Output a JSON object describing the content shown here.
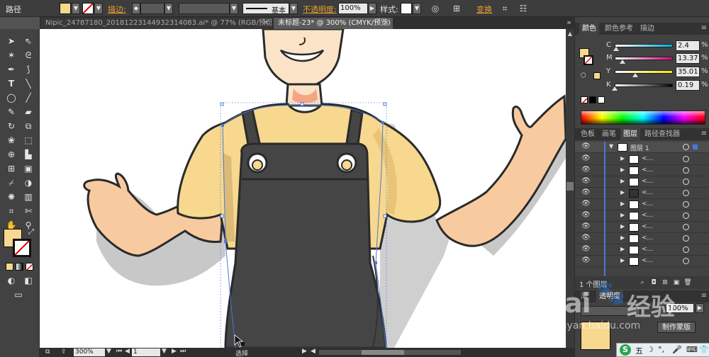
{
  "control_bar": {
    "path_label": "路径",
    "stroke_label": "描边:",
    "stroke_style": "基本",
    "opacity_label": "不透明度:",
    "opacity_value": "100%",
    "style_label": "样式:",
    "transform_label": "变换",
    "fill_color": "#f7d88e"
  },
  "tabs": [
    {
      "label": "Nipic_24787180_20181223144932314083.ai* @ 77% (RGB/预览)",
      "active": false
    },
    {
      "label": "未标题-23* @ 300% (CMYK/预览)",
      "active": true
    }
  ],
  "status": {
    "zoom": "300%",
    "page": "1",
    "tool_label": "选择"
  },
  "color_panel": {
    "tabs": [
      "颜色",
      "颜色参考",
      "描边"
    ],
    "channels": [
      {
        "name": "C",
        "value": "2.4",
        "level": 0.024,
        "gradient": [
          "#ffffff",
          "#00a9e0"
        ]
      },
      {
        "name": "M",
        "value": "13.37",
        "level": 0.1337,
        "gradient": [
          "#ffffff",
          "#e6007e"
        ]
      },
      {
        "name": "Y",
        "value": "35.01",
        "level": 0.3501,
        "gradient": [
          "#ffffff",
          "#ffe500"
        ]
      },
      {
        "name": "K",
        "value": "0.19",
        "level": 0.0019,
        "gradient": [
          "#ffffff",
          "#000000"
        ]
      }
    ],
    "percent": "%"
  },
  "layers_panel": {
    "tabs": [
      "色板",
      "画笔",
      "图层",
      "路径查找器"
    ],
    "top_layer_name": "图层 1",
    "sublayer_names": [
      "<...",
      "<...",
      "<...",
      "<...",
      "<...",
      "<...",
      "<...",
      "<...",
      "<...",
      "<...",
      "<...",
      "<..."
    ],
    "layer_count": "1 个图层"
  },
  "lower_panel": {
    "tab_a": "渐",
    "tab_b": "透明度",
    "opacity_value": "100%",
    "make_mask_button": "制作蒙版"
  },
  "watermark": {
    "brand": "Bai",
    "brand_cn": "经验",
    "url": "jingyan.baidu.com"
  },
  "taskbar": {
    "ime_label": "五"
  }
}
